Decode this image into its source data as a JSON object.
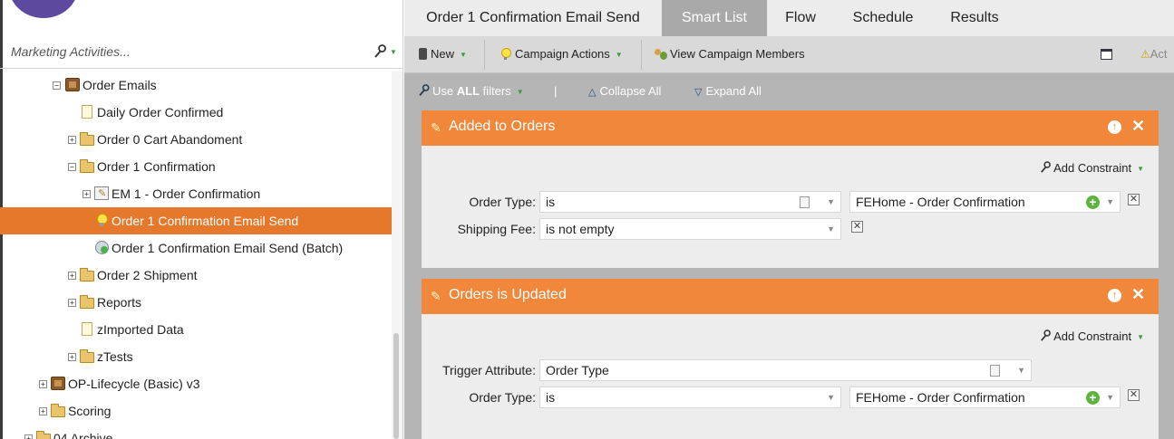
{
  "left_panel": {
    "search_placeholder": "Marketing Activities...",
    "tree": [
      {
        "label": "Order Emails",
        "icon": "program-icon",
        "expander": "−"
      },
      {
        "label": "Daily Order Confirmed",
        "icon": "page-icon",
        "expander": ""
      },
      {
        "label": "Order 0 Cart Abandoment",
        "icon": "folder-icon",
        "expander": "+"
      },
      {
        "label": "Order 1 Confirmation",
        "icon": "folder-icon",
        "expander": "−"
      },
      {
        "label": "EM 1 - Order Confirmation",
        "icon": "email-program-icon",
        "expander": "+"
      },
      {
        "label": "Order 1 Confirmation Email Send",
        "icon": "trigger-campaign-icon",
        "expander": "",
        "selected": true
      },
      {
        "label": "Order 1 Confirmation Email Send (Batch)",
        "icon": "batch-campaign-icon",
        "expander": ""
      },
      {
        "label": "Order 2 Shipment",
        "icon": "folder-icon",
        "expander": "+"
      },
      {
        "label": "Reports",
        "icon": "folder-icon",
        "expander": "+"
      },
      {
        "label": "zImported Data",
        "icon": "page-icon",
        "expander": ""
      },
      {
        "label": "zTests",
        "icon": "folder-icon",
        "expander": "+"
      },
      {
        "label": "OP-Lifecycle (Basic) v3",
        "icon": "program-icon",
        "expander": "+"
      },
      {
        "label": "Scoring",
        "icon": "folder-icon",
        "expander": "+"
      },
      {
        "label": "04 Archive",
        "icon": "folder-icon",
        "expander": "+"
      }
    ]
  },
  "tabs": [
    "Order 1 Confirmation Email Send",
    "Smart List",
    "Flow",
    "Schedule",
    "Results"
  ],
  "active_tab": "Smart List",
  "toolbar": {
    "new_label": "New",
    "campaign_actions_label": "Campaign Actions",
    "view_members_label": "View Campaign Members",
    "warning_label": "Act"
  },
  "filter_bar": {
    "use_prefix": "Use ",
    "use_bold": "ALL",
    "use_suffix": " filters",
    "separator": "|",
    "collapse_label": "Collapse All",
    "expand_label": "Expand All"
  },
  "filters": [
    {
      "title": "Added to Orders",
      "add_constraint_label": "Add Constraint",
      "rows": [
        {
          "label": "Order Type:",
          "operator": "is",
          "value": "FEHome - Order Confirmation"
        },
        {
          "label": "Shipping Fee:",
          "operator": "is not empty"
        }
      ]
    },
    {
      "title": "Orders is Updated",
      "add_constraint_label": "Add Constraint",
      "rows": [
        {
          "label": "Trigger Attribute:",
          "operator": "Order Type"
        },
        {
          "label": "Order Type:",
          "operator": "is",
          "value": "FEHome - Order Confirmation"
        }
      ]
    }
  ],
  "colors": {
    "accent_orange": "#f0873a",
    "selection_orange": "#e6782b",
    "brand_purple": "#5d4a9e",
    "active_tab_gray": "#a9a9a9"
  }
}
